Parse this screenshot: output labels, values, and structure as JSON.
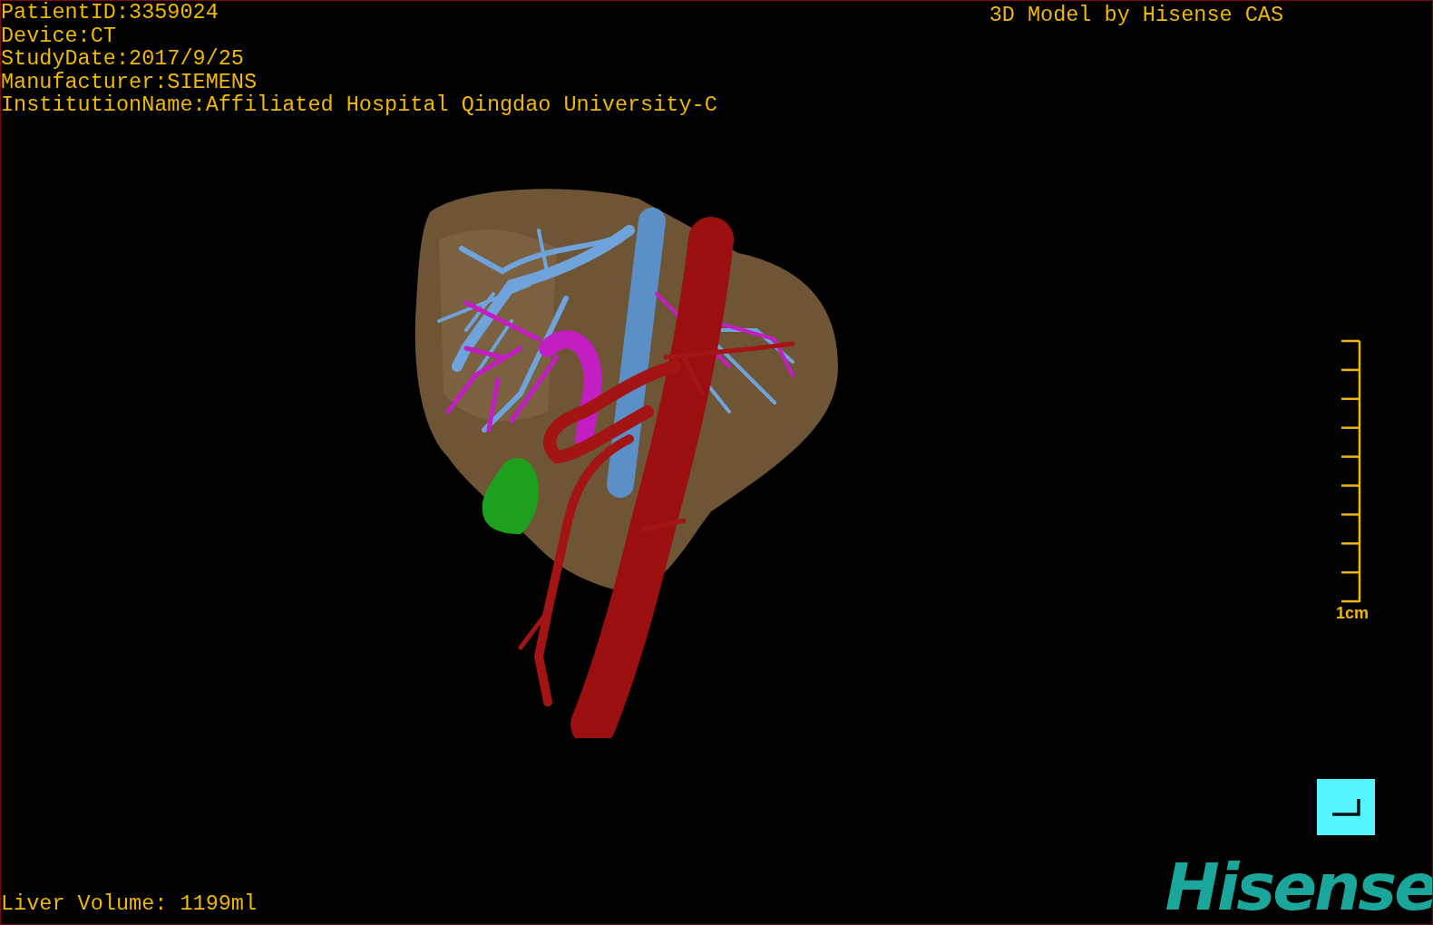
{
  "header_info": [
    "PatientID:3359024",
    "Device:CT",
    "StudyDate:2017/9/25",
    "Manufacturer:SIEMENS",
    "InstitutionName:Affiliated Hospital Qingdao University-C"
  ],
  "title": "3D Model by Hisense CAS",
  "scale": {
    "label": "1cm"
  },
  "liver_volume": "Liver Volume: 1199ml",
  "logo": "Hisense"
}
